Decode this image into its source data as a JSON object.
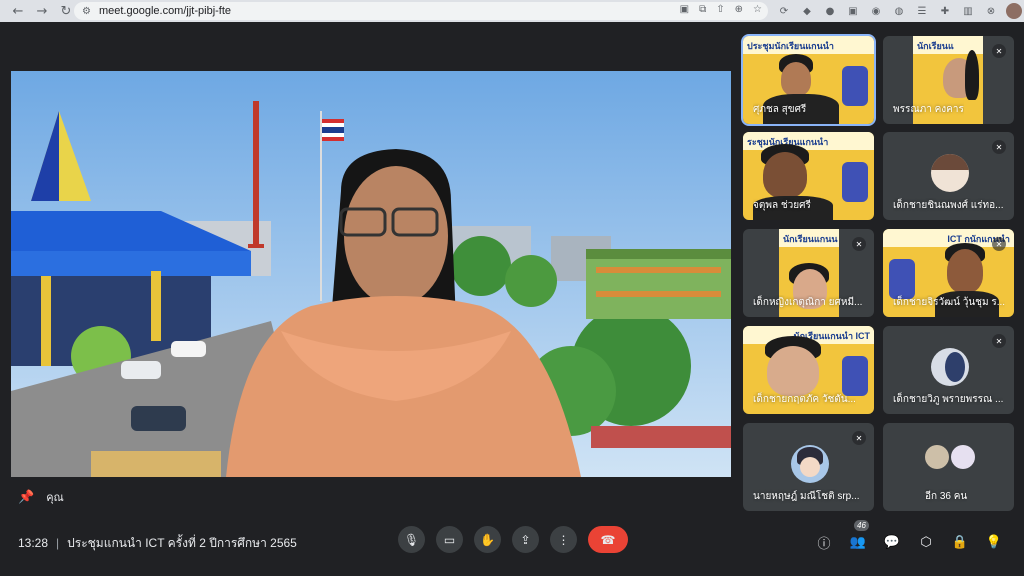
{
  "browser": {
    "url": "meet.google.com/jjt-pibj-fte",
    "nav": {
      "back": "←",
      "forward": "→",
      "reload": "↻"
    }
  },
  "main": {
    "self_label": "คุณ",
    "self_icon": "pin-icon"
  },
  "tiles": [
    {
      "name": "ศุภชล สุขศรี",
      "muted": false,
      "active": true,
      "banner": "ประชุมนักเรียนแกนนำ"
    },
    {
      "name": "พรรณภา คงคาร",
      "muted": true,
      "active": false,
      "banner": "นักเรียนแ"
    },
    {
      "name": "จตุพล ช่วยศรี",
      "muted": false,
      "active": false,
      "banner": "ระชุมนักเรียนแกนนำ"
    },
    {
      "name": "เด็กชายชินณพงศ์ แร่ทอ...",
      "muted": true,
      "active": false,
      "banner": ""
    },
    {
      "name": "เด็กหญิงเกตุณิกา ยศหมี...",
      "muted": true,
      "active": false,
      "banner": "นักเรียนแกนน"
    },
    {
      "name": "เด็กชายจิรวัฒน์ วุ้นชุม ร...",
      "muted": true,
      "active": false,
      "banner": "ICT กนักแกนนำ"
    },
    {
      "name": "เด็กชายกฤตภัค วัชตัน...",
      "muted": false,
      "active": false,
      "banner": "นักเรียนแกนนำ ICT"
    },
    {
      "name": "เด็กชายวิภู พรายพรรณ ...",
      "muted": true,
      "active": false,
      "banner": ""
    },
    {
      "name": "นายหฤษฎ์ มณีโชติ srp...",
      "muted": true,
      "active": false,
      "banner": ""
    },
    {
      "name": "อีก 36 คน",
      "muted": false,
      "active": false,
      "banner": ""
    }
  ],
  "bottom": {
    "time": "13:28",
    "meeting_title": "ประชุมแกนนำ ICT ครั้งที่ 2 ปีการศึกษา 2565",
    "participants_count": "46",
    "controls": {
      "mic": "🎙",
      "camera": "▭",
      "raise_hand": "✋",
      "present": "⇪",
      "more": "⋮",
      "end": "☎"
    }
  },
  "colors": {
    "background": "#202124",
    "tile": "#3c4043",
    "end_call": "#ea4335",
    "active_outline": "#8ab4f8",
    "banner_yellow": "#f2c53d"
  }
}
